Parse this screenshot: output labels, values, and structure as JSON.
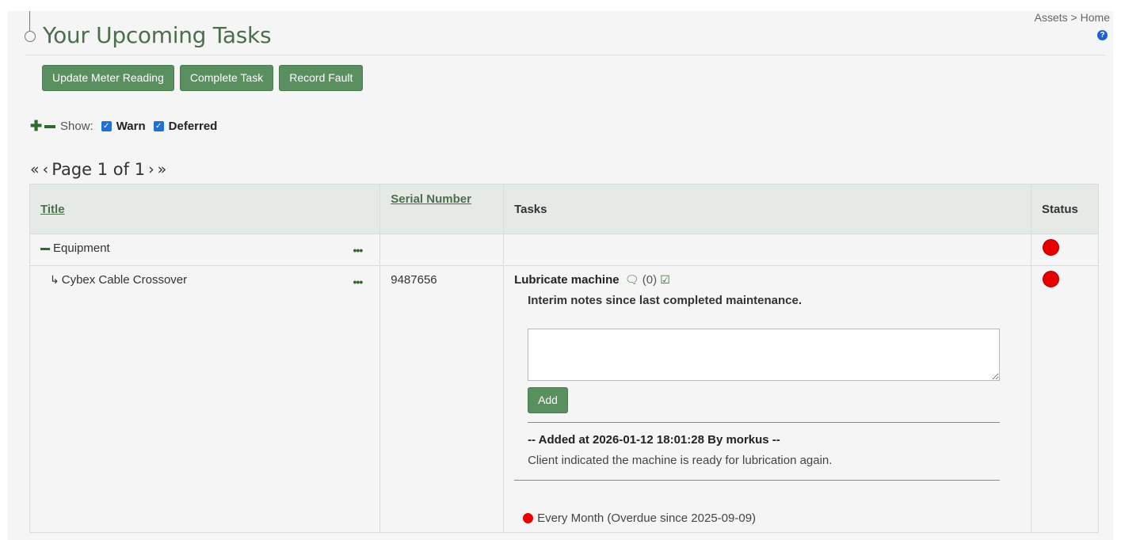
{
  "header": {
    "title": "Your Upcoming Tasks",
    "breadcrumb_assets": "Assets",
    "breadcrumb_sep": " > ",
    "breadcrumb_home": "Home",
    "help_glyph": "?"
  },
  "toolbar": {
    "update_meter": "Update Meter Reading",
    "complete_task": "Complete Task",
    "record_fault": "Record Fault"
  },
  "filters": {
    "show_label": "Show:",
    "warn_label": "Warn",
    "deferred_label": "Deferred"
  },
  "pager": {
    "first": "«",
    "prev": "‹",
    "text": "Page 1 of 1",
    "next": "›",
    "last": "»"
  },
  "table": {
    "columns": {
      "title": "Title",
      "serial": "Serial Number",
      "tasks": "Tasks",
      "status": "Status"
    },
    "group": {
      "label": "Equipment",
      "menu": "•••"
    },
    "item": {
      "title": "Cybex Cable Crossover",
      "menu": "•••",
      "serial": "9487656",
      "task_name": "Lubricate machine",
      "comment_count": "(0)",
      "notes_heading": "Interim notes since last completed maintenance.",
      "add_label": "Add",
      "note_meta": "-- Added at 2026-01-12 18:01:28 By morkus --",
      "note_text": "Client indicated the machine is ready for lubrication again.",
      "frequency": "Every Month (Overdue since 2025-09-09)"
    }
  },
  "colors": {
    "accent": "#5a8f5f",
    "status_red": "#e60000",
    "help_blue": "#1f5fd0"
  }
}
